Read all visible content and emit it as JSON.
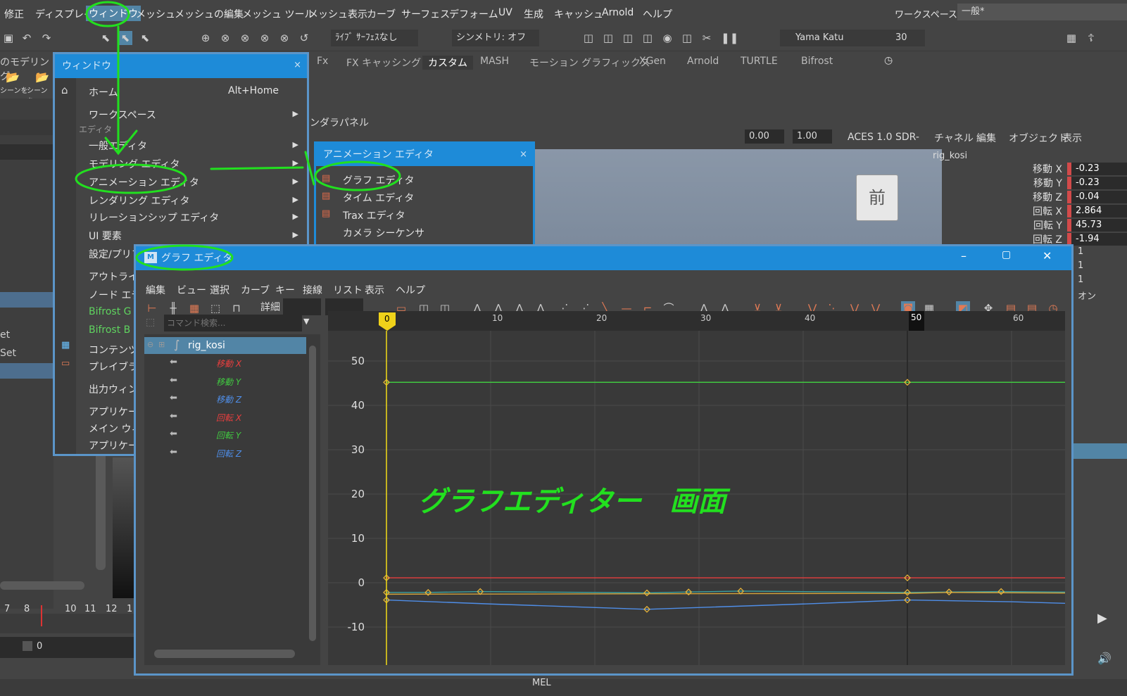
{
  "menubar": {
    "items": [
      "修正",
      "ディスプレイ",
      "ウィンドウ",
      "メッシュ",
      "メッシュの編集",
      "メッシュ ツール",
      "メッシュ表示",
      "カーブ",
      "サーフェス",
      "デフォーム",
      "UV",
      "生成",
      "キャッシュ",
      "Arnold",
      "ヘルプ"
    ],
    "workspace_label": "ワークスペース:",
    "workspace_value": "一般*"
  },
  "toolbar": {
    "live_surface": "ﾗｲﾌﾞ ｻｰﾌｪｽなし",
    "symmetry": "シンメトリ: オフ",
    "user": "Yama Katu",
    "fps": "30"
  },
  "shelf": {
    "left_label": "のモデリング",
    "left_buttons": [
      "シーンを",
      "シーンを"
    ],
    "tabs": [
      "Fx",
      "FX キャッシング",
      "カスタム",
      "MASH",
      "モーション グラフィックス",
      "XGen",
      "Arnold",
      "TURTLE",
      "Bifrost"
    ]
  },
  "viewport": {
    "menu": [
      "ンダラ",
      "パネル"
    ],
    "exposure": "0.00",
    "gamma": "1.00",
    "color_space": "ACES 1.0 SDR-",
    "view_cube": "前"
  },
  "channel_box": {
    "menu": [
      "チャネル",
      "編集",
      "オブジェクト",
      "表示"
    ],
    "object": "rig_kosi",
    "channels": [
      {
        "label": "移動 X",
        "value": "-0.23"
      },
      {
        "label": "移動 Y",
        "value": "-0.23"
      },
      {
        "label": "移動 Z",
        "value": "-0.04"
      },
      {
        "label": "回転 X",
        "value": "2.864"
      },
      {
        "label": "回転 Y",
        "value": "45.73"
      },
      {
        "label": "回転 Z",
        "value": "-1.94"
      }
    ],
    "extra_values": [
      "1",
      "1",
      "1",
      "オン"
    ]
  },
  "window_menu": {
    "title": "ウィンドウ",
    "home": "ホーム",
    "home_shortcut": "Alt+Home",
    "workspace": "ワークスペース",
    "section_editors": "エディタ",
    "items": [
      "一般エディタ",
      "モデリング エディタ",
      "アニメーション エディタ",
      "レンダリング エディタ",
      "リレーションシップ エディタ",
      "UI 要素",
      "設定/プリファ"
    ],
    "items2": [
      "アウトライナ",
      "ノード エディ"
    ],
    "bifrost": [
      "Bifrost G",
      "Bifrost B"
    ],
    "items3": [
      "コンテンツ ブ",
      "プレイブラス"
    ],
    "items4": [
      "出力ウィン"
    ],
    "items5": [
      "アプリケーシ",
      "メイン ウィ",
      "アプリケーシ"
    ]
  },
  "anim_submenu": {
    "title": "アニメーション エディタ",
    "items": [
      "グラフ エディタ",
      "タイム エディタ",
      "Trax エディタ",
      "カメラ シーケンサ"
    ]
  },
  "graph_editor": {
    "title": "グラフ エディタ",
    "menu": [
      "編集",
      "ビュー",
      "選択",
      "カーブ",
      "キー",
      "接線",
      "リスト",
      "表示",
      "ヘルプ"
    ],
    "detail_label": "詳細",
    "search_placeholder": "コマンド検索...",
    "node": "rig_kosi",
    "channels": [
      {
        "label": "移動 X",
        "color": "#e83e3e"
      },
      {
        "label": "移動 Y",
        "color": "#41c841"
      },
      {
        "label": "移動 Z",
        "color": "#4f8ee8"
      },
      {
        "label": "回転 X",
        "color": "#e83e3e"
      },
      {
        "label": "回転 Y",
        "color": "#41c841"
      },
      {
        "label": "回転 Z",
        "color": "#4f8ee8"
      }
    ],
    "current_frame": "0",
    "end_marker": "50",
    "y_ticks": [
      "50",
      "40",
      "30",
      "20",
      "10",
      "0",
      "-10"
    ],
    "x_ticks": [
      "10",
      "20",
      "30",
      "40",
      "60"
    ]
  },
  "annotation": {
    "text": "グラフエディター　画面",
    "color": "#22e01f"
  },
  "left_panel": {
    "items": [
      "et",
      "Set"
    ],
    "timeline_ticks": [
      "7",
      "8",
      "10",
      "11",
      "12",
      "1"
    ],
    "frame_field": "0"
  },
  "statusbar": {
    "mel": "MEL"
  }
}
